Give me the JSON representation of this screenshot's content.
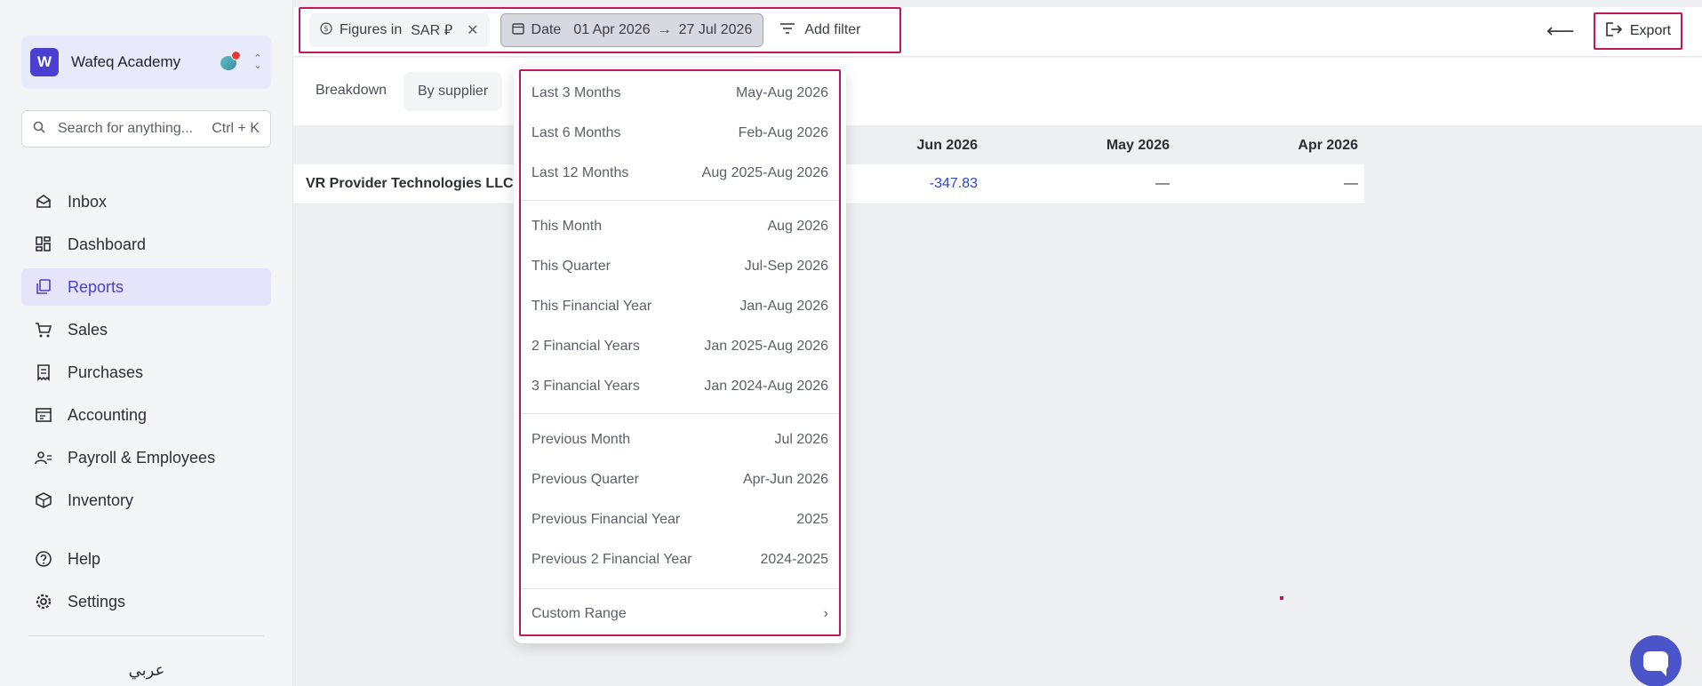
{
  "sidebar": {
    "org_name": "Wafeq Academy",
    "org_logo": "W",
    "search_placeholder": "Search for anything...",
    "search_shortcut": "Ctrl + K",
    "nav": [
      {
        "label": "Inbox",
        "icon": "inbox-icon"
      },
      {
        "label": "Dashboard",
        "icon": "dashboard-icon"
      },
      {
        "label": "Reports",
        "icon": "reports-icon",
        "active": true
      },
      {
        "label": "Sales",
        "icon": "cart-icon"
      },
      {
        "label": "Purchases",
        "icon": "receipt-icon"
      },
      {
        "label": "Accounting",
        "icon": "ledger-icon"
      },
      {
        "label": "Payroll & Employees",
        "icon": "people-icon"
      },
      {
        "label": "Inventory",
        "icon": "box-icon"
      }
    ],
    "nav_bottom": [
      {
        "label": "Help",
        "icon": "help-icon"
      },
      {
        "label": "Settings",
        "icon": "gear-icon"
      }
    ],
    "language": "عربي"
  },
  "topbar": {
    "figures_label": "Figures in",
    "currency": "SAR ⃁",
    "date_label": "Date",
    "date_from": "01 Apr 2026",
    "date_to": "27 Jul 2026",
    "add_filter": "Add filter",
    "export": "Export"
  },
  "breakdown": {
    "label": "Breakdown",
    "option": "By supplier"
  },
  "table": {
    "headers": [
      "Jun 2026",
      "May 2026",
      "Apr 2026"
    ],
    "rows": [
      {
        "supplier": "VR Provider Technologies LLC",
        "values": [
          "-347.83",
          "—",
          "—"
        ]
      }
    ]
  },
  "date_menu": {
    "groups": [
      [
        {
          "label": "Last 3 Months",
          "range": "May-Aug 2026"
        },
        {
          "label": "Last 6 Months",
          "range": "Feb-Aug 2026"
        },
        {
          "label": "Last 12 Months",
          "range": "Aug 2025-Aug 2026"
        }
      ],
      [
        {
          "label": "This Month",
          "range": "Aug 2026"
        },
        {
          "label": "This Quarter",
          "range": "Jul-Sep 2026"
        },
        {
          "label": "This Financial Year",
          "range": "Jan-Aug 2026"
        },
        {
          "label": "2 Financial Years",
          "range": "Jan 2025-Aug 2026"
        },
        {
          "label": "3 Financial Years",
          "range": "Jan 2024-Aug 2026"
        }
      ],
      [
        {
          "label": "Previous Month",
          "range": "Jul 2026"
        },
        {
          "label": "Previous Quarter",
          "range": "Apr-Jun 2026"
        },
        {
          "label": "Previous Financial Year",
          "range": "2025"
        },
        {
          "label": "Previous 2 Financial Year",
          "range": "2024-2025"
        }
      ]
    ],
    "custom_range": "Custom Range"
  },
  "colors": {
    "accent": "#4b3fd1",
    "highlight_border": "#c0185a",
    "negative_value": "#2e43c9"
  }
}
